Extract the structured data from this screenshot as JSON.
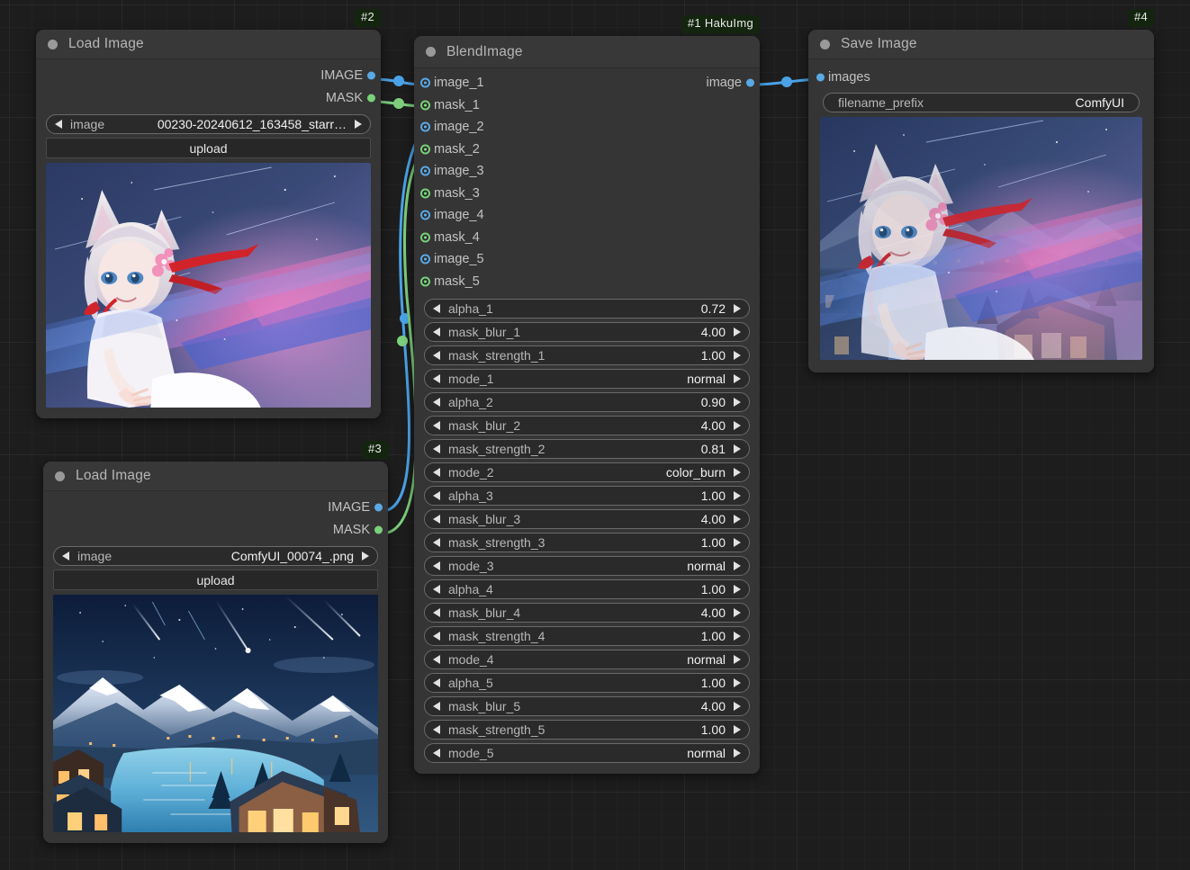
{
  "app": {
    "name": "ComfyUI",
    "canvas_background": "#1d1d1d"
  },
  "colors": {
    "image_link": "#4aa3e8",
    "mask_link": "#7dcf7d",
    "node_body": "#353535",
    "badge_bg": "#14250f",
    "accent_blue": "#5aa9e6",
    "accent_green": "#79d179"
  },
  "nodes": [
    {
      "id": "load-image-2",
      "badge": "#2",
      "title": "Load Image",
      "outputs": [
        {
          "label": "IMAGE",
          "type": "IMAGE",
          "color": "blue"
        },
        {
          "label": "MASK",
          "type": "MASK",
          "color": "green"
        }
      ],
      "widgets": [
        {
          "name": "image",
          "label": "image",
          "value": "00230-20240612_163458_starr…",
          "kind": "combo"
        }
      ],
      "button": "upload",
      "preview_alt": "anime girl with cat ears, white hair, red ribbon, starry night sky"
    },
    {
      "id": "load-image-3",
      "badge": "#3",
      "title": "Load Image",
      "outputs": [
        {
          "label": "IMAGE",
          "type": "IMAGE",
          "color": "blue"
        },
        {
          "label": "MASK",
          "type": "MASK",
          "color": "green"
        }
      ],
      "widgets": [
        {
          "name": "image",
          "label": "image",
          "value": "ComfyUI_00074_.png",
          "kind": "combo"
        }
      ],
      "button": "upload",
      "preview_alt": "night mountain lake village with meteors"
    },
    {
      "id": "blend-image-1",
      "badge": "#1 HakuImg",
      "title": "BlendImage",
      "inputs": [
        {
          "label": "image_1",
          "color": "blue"
        },
        {
          "label": "mask_1",
          "color": "green"
        },
        {
          "label": "image_2",
          "color": "blue"
        },
        {
          "label": "mask_2",
          "color": "green"
        },
        {
          "label": "image_3",
          "color": "blue"
        },
        {
          "label": "mask_3",
          "color": "green"
        },
        {
          "label": "image_4",
          "color": "blue"
        },
        {
          "label": "mask_4",
          "color": "green"
        },
        {
          "label": "image_5",
          "color": "blue"
        },
        {
          "label": "mask_5",
          "color": "green"
        }
      ],
      "outputs": [
        {
          "label": "image",
          "color": "blue"
        }
      ],
      "widgets": [
        {
          "label": "alpha_1",
          "value": "0.72"
        },
        {
          "label": "mask_blur_1",
          "value": "4.00"
        },
        {
          "label": "mask_strength_1",
          "value": "1.00"
        },
        {
          "label": "mode_1",
          "value": "normal"
        },
        {
          "label": "alpha_2",
          "value": "0.90"
        },
        {
          "label": "mask_blur_2",
          "value": "4.00"
        },
        {
          "label": "mask_strength_2",
          "value": "0.81"
        },
        {
          "label": "mode_2",
          "value": "color_burn"
        },
        {
          "label": "alpha_3",
          "value": "1.00"
        },
        {
          "label": "mask_blur_3",
          "value": "4.00"
        },
        {
          "label": "mask_strength_3",
          "value": "1.00"
        },
        {
          "label": "mode_3",
          "value": "normal"
        },
        {
          "label": "alpha_4",
          "value": "1.00"
        },
        {
          "label": "mask_blur_4",
          "value": "4.00"
        },
        {
          "label": "mask_strength_4",
          "value": "1.00"
        },
        {
          "label": "mode_4",
          "value": "normal"
        },
        {
          "label": "alpha_5",
          "value": "1.00"
        },
        {
          "label": "mask_blur_5",
          "value": "4.00"
        },
        {
          "label": "mask_strength_5",
          "value": "1.00"
        },
        {
          "label": "mode_5",
          "value": "normal"
        }
      ]
    },
    {
      "id": "save-image-4",
      "badge": "#4",
      "title": "Save Image",
      "inputs": [
        {
          "label": "images",
          "color": "blue"
        }
      ],
      "widgets": [
        {
          "label": "filename_prefix",
          "value": "ComfyUI",
          "kind": "text"
        }
      ],
      "preview_alt": "blended composite: anime girl over night village"
    }
  ]
}
